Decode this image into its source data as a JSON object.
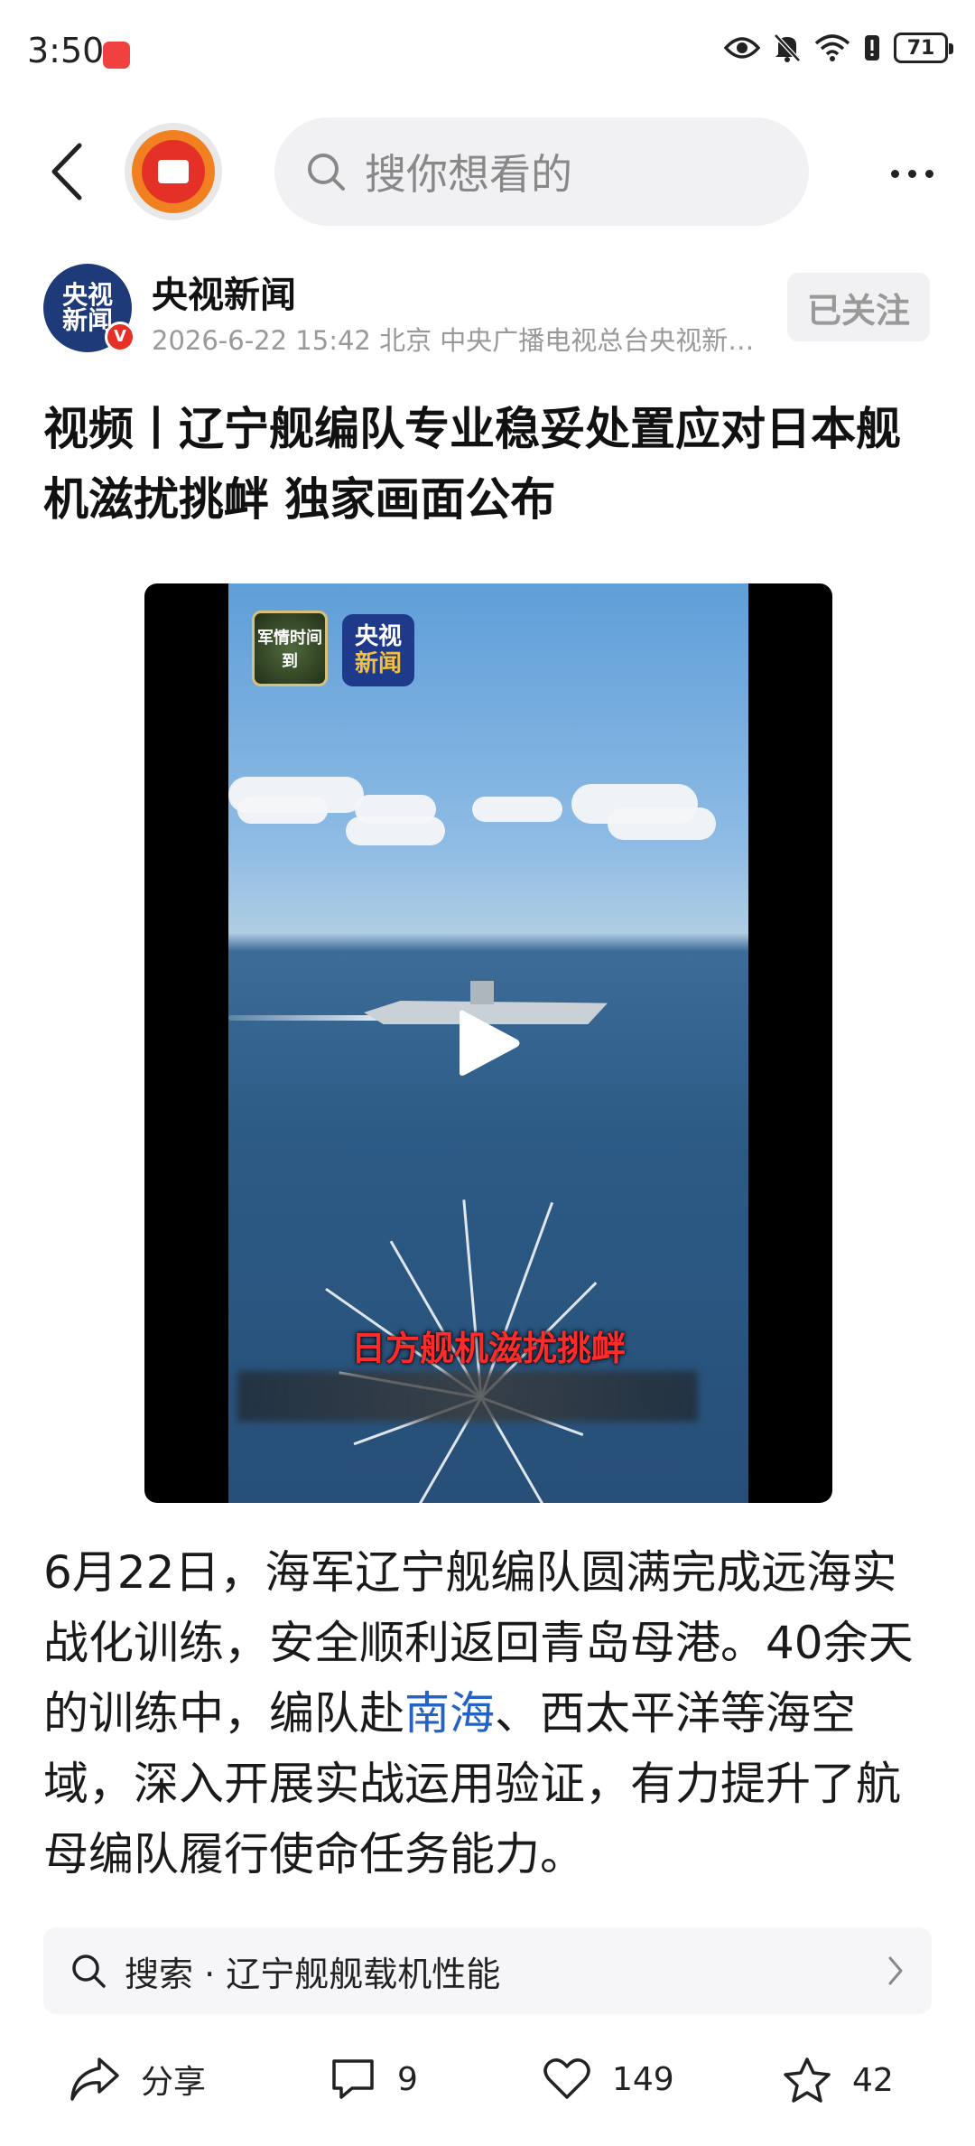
{
  "status_bar": {
    "time": "3:50",
    "battery": "71"
  },
  "nav": {
    "search_placeholder": "搜你想看的"
  },
  "author": {
    "avatar_text_line1": "央视",
    "avatar_text_line2": "新闻",
    "verified_badge": "V",
    "name": "央视新闻",
    "meta": "2026-6-22  15:42  北京  中央广播电视总台央视新…",
    "follow_label": "已关注"
  },
  "article": {
    "headline": "视频丨辽宁舰编队专业稳妥处置应对日本舰机滋扰挑衅 独家画面公布",
    "body_before_link": "6月22日，海军辽宁舰编队圆满完成远海实战化训练，安全顺利返回青岛母港。40余天的训练中，编队赴",
    "body_link": "南海",
    "body_after_link": "、西太平洋等海空域，深入开展实战运用验证，有力提升了航母编队履行使命任务能力。"
  },
  "video": {
    "logo_a_text": "军情时间到",
    "logo_b_line1": "央视",
    "logo_b_line2": "新闻",
    "caption": "日方舰机滋扰挑衅"
  },
  "suggestion": {
    "label": "搜索 · 辽宁舰舰载机性能"
  },
  "actions": {
    "share_label": "分享",
    "comment_count": "9",
    "like_count": "149",
    "favorite_count": "42"
  },
  "colors": {
    "link": "#2462c4",
    "accent_red": "#e53028",
    "caption_red": "#ff2a2a"
  }
}
